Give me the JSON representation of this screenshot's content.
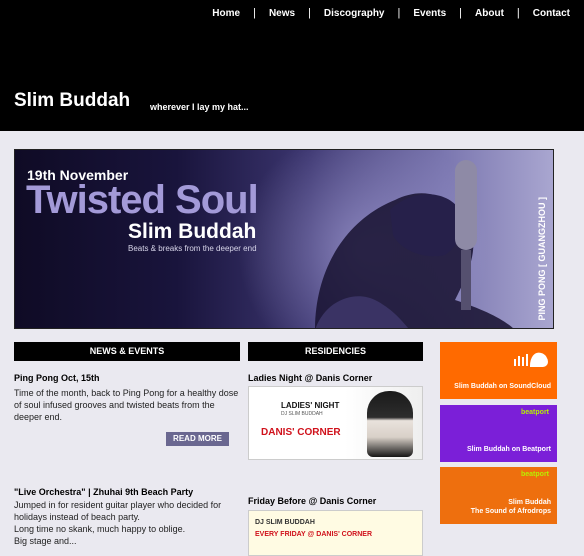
{
  "nav": [
    "Home",
    "News",
    "Discography",
    "Events",
    "About",
    "Contact"
  ],
  "site": {
    "title": "Slim Buddah",
    "tagline": "wherever I lay my hat..."
  },
  "banner": {
    "date": "19th November",
    "event": "Twisted Soul",
    "artist": "Slim Buddah",
    "subtitle": "Beats & breaks from the deeper end",
    "venue": "PING PONG [ GUANGZHOU ]"
  },
  "columns": {
    "news": "NEWS & EVENTS",
    "residencies": "RESIDENCIES"
  },
  "news": [
    {
      "title": "Ping Pong Oct, 15th",
      "body": "Time of the month, back to Ping Pong for a healthy dose of soul infused grooves and twisted beats from the deeper end."
    },
    {
      "title": "\"Live Orchestra\" | Zhuhai 9th Beach Party",
      "body1": "Jumped in for resident guitar player who decided for holidays instead of beach party.",
      "body2": "Long time no skank, much happy to oblige.",
      "body3": "Big stage and..."
    }
  ],
  "read_more": "READ MORE",
  "residencies": [
    {
      "title": "Ladies Night @ Danis Corner",
      "flyer_line1": "LADIES' NIGHT",
      "flyer_line2": "DJ SLIM BUDDAH",
      "flyer_line3": "DANIS' CORNER"
    },
    {
      "title": "Friday Before @ Danis Corner",
      "flyer_line1": "DJ SLIM BUDDAH",
      "flyer_line2": "EVERY FRIDAY @ DANIS' CORNER"
    }
  ],
  "sidebar": [
    {
      "brand": "",
      "label1": "Slim Buddah on SoundCloud",
      "label2": "",
      "color": "#ff6a00"
    },
    {
      "brand": "beatport",
      "label1": "Slim Buddah on Beatport",
      "label2": "",
      "color": "#7b1fd8"
    },
    {
      "brand": "beatport",
      "label1": "Slim Buddah",
      "label2": "The Sound of Afrodrops",
      "color": "#ee6f0e"
    }
  ]
}
